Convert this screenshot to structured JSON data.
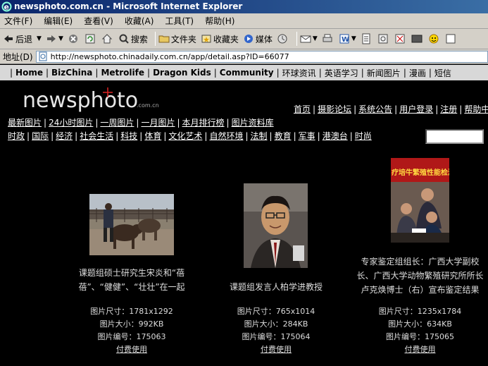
{
  "window": {
    "title": "newsphoto.com.cn - Microsoft Internet Explorer"
  },
  "menu": [
    "文件(F)",
    "编辑(E)",
    "查看(V)",
    "收藏(A)",
    "工具(T)",
    "帮助(H)"
  ],
  "toolbar": {
    "back": "后退",
    "search": "搜索",
    "folders": "文件夹",
    "favorites": "收藏夹",
    "media": "媒体"
  },
  "address": {
    "label": "地址(D)",
    "url": "http://newsphoto.chinadaily.com.cn/app/detail.asp?ID=66077"
  },
  "topnav": {
    "en": [
      "Home",
      "BizChina",
      "Metrolife",
      "Dragon Kids",
      "Community"
    ],
    "cn": [
      "环球资讯",
      "英语学习",
      "新闻图片",
      "漫画",
      "短信"
    ]
  },
  "logo": {
    "main": "newsphoto",
    "suffix": ".com.cn"
  },
  "right_links": [
    "首页",
    "摄影论坛",
    "系统公告",
    "用户登录",
    "注册",
    "帮助中心"
  ],
  "subnav1": [
    "最新图片",
    "24小时图片",
    "一周图片",
    "一月图片",
    "本月排行榜",
    "图片资料库"
  ],
  "subnav2": [
    "时政",
    "国际",
    "经济",
    "社会生活",
    "科技",
    "体育",
    "文化艺术",
    "自然环境",
    "法制",
    "教育",
    "军事",
    "港澳台",
    "时尚"
  ],
  "photos": [
    {
      "caption_line1": "课题组硕士研究生宋炎和“蓓",
      "caption_line2": "蓓”、“健健”、“壮壮”在一起",
      "caption_line3": "",
      "size": "图片尺寸：1781x1292",
      "filesize": "图片大小：992KB",
      "id": "图片编号：175063",
      "link": "付费使用"
    },
    {
      "caption_line1": "课题组发言人柏学进教授",
      "size": "图片尺寸：765x1014",
      "filesize": "图片大小：284KB",
      "id": "图片编号：175064",
      "link": "付费使用"
    },
    {
      "caption_line1": "专家鉴定组组长：广西大学副校",
      "caption_line2": "长、广西大学动物繁殖研究所所长",
      "caption_line3": "卢克焕博士（右）宣布鉴定结果",
      "banner": "疗培牛繁殖性能检测",
      "size": "图片尺寸：1235x1784",
      "filesize": "图片大小：634KB",
      "id": "图片编号：175065",
      "link": "付费使用"
    }
  ],
  "colors": {
    "titlebar": "#0a246a",
    "page_bg": "#000000",
    "chrome": "#d4d0c8"
  }
}
